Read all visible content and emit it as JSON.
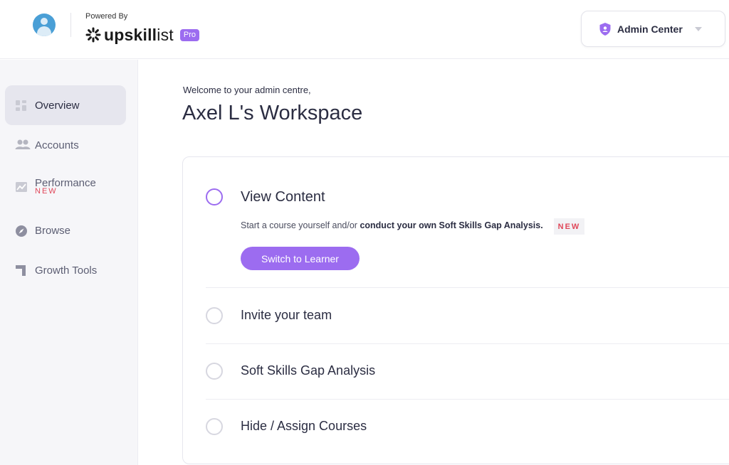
{
  "header": {
    "powered_by": "Powered By",
    "brand_name_bold": "upskill",
    "brand_name_rest": "ist",
    "pro_label": "Pro",
    "admin_center_label": "Admin Center"
  },
  "sidebar": {
    "items": [
      {
        "label": "Overview",
        "icon": "grid-icon",
        "active": true
      },
      {
        "label": "Accounts",
        "icon": "users-icon"
      },
      {
        "label": "Performance",
        "icon": "chart-icon",
        "badge": "NEW"
      },
      {
        "label": "Browse",
        "icon": "compass-icon"
      },
      {
        "label": "Growth Tools",
        "icon": "growth-icon"
      }
    ]
  },
  "main": {
    "welcome": "Welcome to your admin centre,",
    "workspace_title": "Axel L's Workspace",
    "steps": [
      {
        "title": "View Content",
        "desc_prefix": "Start a course yourself and/or ",
        "desc_bold": "conduct your own Soft Skills Gap Analysis.",
        "badge": "NEW",
        "button": "Switch to Learner"
      },
      {
        "title": "Invite your team"
      },
      {
        "title": "Soft Skills Gap Analysis"
      },
      {
        "title": "Hide / Assign Courses"
      }
    ]
  },
  "colors": {
    "accent": "#9c6cf0",
    "new_badge": "#e0485a",
    "avatar": "#4a9fd6",
    "sidebar_bg": "#f6f6f9",
    "active_item_bg": "#e6e6ee"
  }
}
